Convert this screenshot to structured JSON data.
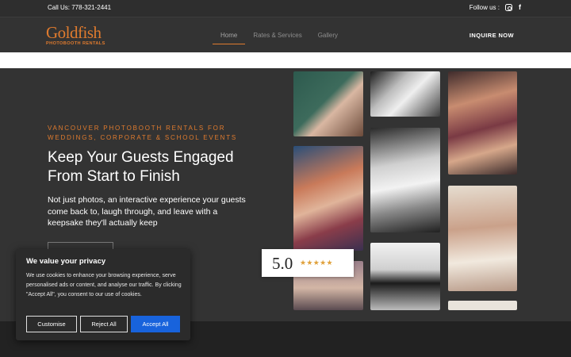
{
  "topbar": {
    "phone": "Call Us: 778-321-2441",
    "follow_label": "Follow us :",
    "social_icons": [
      "instagram-icon",
      "facebook-icon"
    ],
    "facebook_glyph": "f"
  },
  "logo": {
    "brand": "Goldfish",
    "subtitle": "PHOTOBOOTH RENTALS"
  },
  "nav": {
    "items": [
      {
        "label": "Home",
        "active": true
      },
      {
        "label": "Rates & Services",
        "active": false
      },
      {
        "label": "Gallery",
        "active": false
      }
    ],
    "cta": "INQUIRE NOW"
  },
  "hero": {
    "tagline": "VANCOUVER PHOTOBOOTH RENTALS FOR WEDDINGS, CORPORATE & SCHOOL EVENTS",
    "headline": "Keep Your Guests Engaged From Start to Finish",
    "lead": "Not just photos, an interactive experience your guests come back to, laugh through, and leave with a keepsake they'll actually keep"
  },
  "rating": {
    "score": "5.0",
    "stars": "★★★★★"
  },
  "cookie": {
    "title": "We value your privacy",
    "text": "We use cookies to enhance your browsing experience, serve personalised ads or content, and analyse our traffic. By clicking \"Accept All\", you consent to our use of cookies.",
    "customise": "Customise",
    "reject": "Reject All",
    "accept": "Accept All"
  },
  "colors": {
    "accent": "#e07b2e",
    "background": "#333333",
    "accept_button": "#1863dc"
  }
}
